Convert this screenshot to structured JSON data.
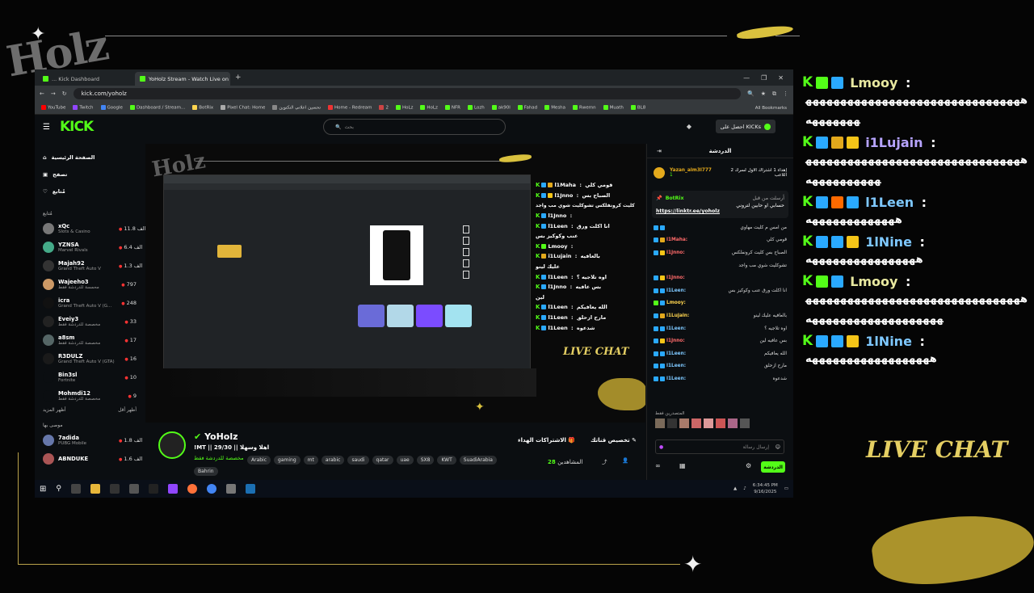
{
  "overlay": {
    "logo_text": "Holz",
    "live_chat_big": "LIVE CHAT",
    "live_chat_small": "LIVE CHAT"
  },
  "browser": {
    "tabs": [
      {
        "label": "... Kick Dashboard"
      },
      {
        "label": "YoHolz Stream - Watch Live on Kick"
      }
    ],
    "new_tab": "+",
    "window_controls": [
      "—",
      "❐",
      "✕"
    ],
    "url": "kick.com/yoholz",
    "bookmarks": [
      "YouTube",
      "Twitch",
      "Google",
      "Dashboard / Stream...",
      "BotRix",
      "Pixel Chat: Home",
      "تحسين اعلاني التكتوين",
      "Home - Redream",
      "2",
      "HoLz",
      "HoLz",
      "NFR",
      "Lozh",
      "ak90l",
      "Fahad",
      "Mesha",
      "Rwemn",
      "Muath",
      "BL8"
    ],
    "all_bookmarks": "All Bookmarks"
  },
  "kick": {
    "logo": "KICK",
    "search_placeholder": "بحث",
    "get_kicks": "احصل على KICKs",
    "nav": [
      {
        "label": "الصفحة الرئيسية",
        "icon": "home-icon"
      },
      {
        "label": "تصفح",
        "icon": "browse-icon"
      },
      {
        "label": "مُتابع",
        "icon": "heart-icon"
      }
    ],
    "following_heading": "مُتابع",
    "channels": [
      {
        "name": "xQc",
        "game": "Slots & Casino",
        "viewers": "11.8 الف"
      },
      {
        "name": "YZNSA",
        "game": "Marvel Rivals",
        "viewers": "6.4 الف"
      },
      {
        "name": "Majah92",
        "game": "Grand Theft Auto V",
        "viewers": "1.3 الف"
      },
      {
        "name": "Wajeeho3",
        "game": "محمسة للدردشة فقط",
        "viewers": "797"
      },
      {
        "name": "icra",
        "game": "Grand Theft Auto V (G...",
        "viewers": "248"
      },
      {
        "name": "Eveiy3",
        "game": "مخصصة للدردشة فقط",
        "viewers": "33"
      },
      {
        "name": "a8sm",
        "game": "مخصصة للدردشة فقط",
        "viewers": "17"
      },
      {
        "name": "R3DULZ",
        "game": "Grand Theft Auto V (GTA)",
        "viewers": "16"
      },
      {
        "name": "Bin3sl",
        "game": "Fortnite",
        "viewers": "10"
      },
      {
        "name": "Mohmdi12",
        "game": "مخصصة للدردشة فقط",
        "viewers": "9"
      }
    ],
    "show_more": "أظهر المزيد",
    "show_less": "أظهر أقل",
    "recommended_heading": "موصى بها",
    "recommended": [
      {
        "name": "7adida",
        "game": "PUBG Mobile",
        "viewers": "1.8 الف"
      },
      {
        "name": "ABNDUKE",
        "game": "",
        "viewers": "1.6 الف"
      }
    ]
  },
  "overlay_chat": [
    {
      "name": "l1Maha",
      "msg": "قومي كلي",
      "color": "#ffffff"
    },
    {
      "name": "l1Jnno",
      "msg": "الصباح بس",
      "color": "#ffffff"
    },
    {
      "name": "",
      "msg": "كليت كرونفلكس تشوكليت شوي مب واجد",
      "color": "#ffffff"
    },
    {
      "name": "l1Jnno",
      "msg": "",
      "color": "#ffffff"
    },
    {
      "name": "l1Leen",
      "msg": "انا اكلت ورق",
      "color": "#ffffff"
    },
    {
      "name": "",
      "msg": "عنب وكوكيز بس",
      "color": "#ffffff"
    },
    {
      "name": "Lmooy",
      "msg": "",
      "color": "#ffffff"
    },
    {
      "name": "i1Lujain",
      "msg": "بالعافيه",
      "color": "#ffffff"
    },
    {
      "name": "",
      "msg": "عليك لينو",
      "color": "#ffffff"
    },
    {
      "name": "l1Leen",
      "msg": "اوه تلاجيه ؟",
      "color": "#ffffff"
    },
    {
      "name": "l1Jnno",
      "msg": "بس عافيه",
      "color": "#ffffff"
    },
    {
      "name": "",
      "msg": "لين",
      "color": "#ffffff"
    },
    {
      "name": "l1Leen",
      "msg": "الله يعافيكم",
      "color": "#ffffff"
    },
    {
      "name": "l1Leen",
      "msg": "مارح ازحلق",
      "color": "#ffffff"
    },
    {
      "name": "l1Leen",
      "msg": "شدعوه",
      "color": "#ffffff"
    }
  ],
  "stream": {
    "channel_name": "YoHolz",
    "title": "!MT || 29/30 || اهلا وسهلا",
    "category": "مخصصة للدردشة فقط",
    "tags": [
      "Arabic",
      "gaming",
      "mt",
      "arabic",
      "saudi",
      "qatar",
      "uae",
      "SX8",
      "KWT",
      "SuadiArabia"
    ],
    "tags_row2": [
      "Bahrin"
    ],
    "subscriptions_button": "الاشتراكات الهداء",
    "customize_button": "تخصيص قناتك",
    "viewers_label": "المشاهدين",
    "viewers": "28"
  },
  "chat": {
    "title": "الدردشة",
    "gifter_name": "Yazan_alm3l777",
    "gifter_count": "1",
    "gift_text": "إهداء 1 اشتراك الاول لسرك 2 اللاعب",
    "pinned_author": "BotRix",
    "pinned_by": "أرسلت من قبل",
    "pinned_text": "حسابي او حابين لتروني",
    "pinned_link": "https://linktr.ee/yoholz",
    "messages": [
      {
        "name": "",
        "msg": "من امس م كليت مهاوي",
        "color": "#ffffff"
      },
      {
        "name": "l1Maha:",
        "msg": "قومي كلي",
        "color": "#ff6a6a"
      },
      {
        "name": "l1Jnno:",
        "msg": "الصباح بس كليت كرونفلكس",
        "color": "#ff6a6a"
      },
      {
        "name": "",
        "msg": "تشوكليت شوي مب واجد",
        "color": "#ffffff"
      },
      {
        "name": "l1Jnno:",
        "msg": "",
        "color": "#ff6a6a"
      },
      {
        "name": "l1Leen:",
        "msg": "انا اكلت ورق عنب وكوكيز بس",
        "color": "#7ec8ff"
      },
      {
        "name": "Lmooy:",
        "msg": "",
        "color": "#ffd54f"
      },
      {
        "name": "i1Lujain:",
        "msg": "بالعافيه عليك لينو",
        "color": "#ffd54f"
      },
      {
        "name": "l1Leen:",
        "msg": "اوه تلاجيه ؟",
        "color": "#7ec8ff"
      },
      {
        "name": "l1Jnno:",
        "msg": "بس عافيه لين",
        "color": "#ff6a6a"
      },
      {
        "name": "l1Leen:",
        "msg": "الله يعافيكم",
        "color": "#7ec8ff"
      },
      {
        "name": "l1Leen:",
        "msg": "مارح ازحلق",
        "color": "#7ec8ff"
      },
      {
        "name": "l1Leen:",
        "msg": "شدعوه",
        "color": "#7ec8ff"
      }
    ],
    "mods_label": "المتصدرين فقط",
    "input_placeholder": "إرسال رسالة",
    "send_label": "الدردشة"
  },
  "taskbar": {
    "time": "6:34:45 PM",
    "date": "9/16/2025"
  },
  "big_chat": [
    {
      "name": "Lmooy",
      "msg": "هههههههههههههههههههههههههههههههههههههههه",
      "color": "#e8e8a0",
      "badges": [
        "#53fc18",
        "#2aa9ff"
      ]
    },
    {
      "name": "i1Lujain",
      "msg": "ههههههههههههههههههههههههههههههههههههههههههه",
      "color": "#b7a4ff",
      "badges": [
        "#2aa9ff",
        "#e3a91c",
        "#f5c518"
      ]
    },
    {
      "name": "l1Leen",
      "msg": "هههههههههههههه",
      "color": "#7ec8ff",
      "badges": [
        "#2aa9ff",
        "#ff6a00",
        "#2aa9ff"
      ]
    },
    {
      "name": "1lNine",
      "msg": "ههههههههههههههههه",
      "color": "#7ec8ff",
      "badges": [
        "#2aa9ff",
        "#2aa9ff",
        "#f5c518"
      ]
    },
    {
      "name": "Lmooy",
      "msg": "هههههههههههههههههههههههههههههههههههههههههههههههههههه",
      "color": "#e8e8a0",
      "badges": [
        "#53fc18",
        "#2aa9ff"
      ]
    },
    {
      "name": "1lNine",
      "msg": "ههههههههههههههههههه",
      "color": "#7ec8ff",
      "badges": [
        "#2aa9ff",
        "#2aa9ff",
        "#f5c518"
      ]
    }
  ]
}
